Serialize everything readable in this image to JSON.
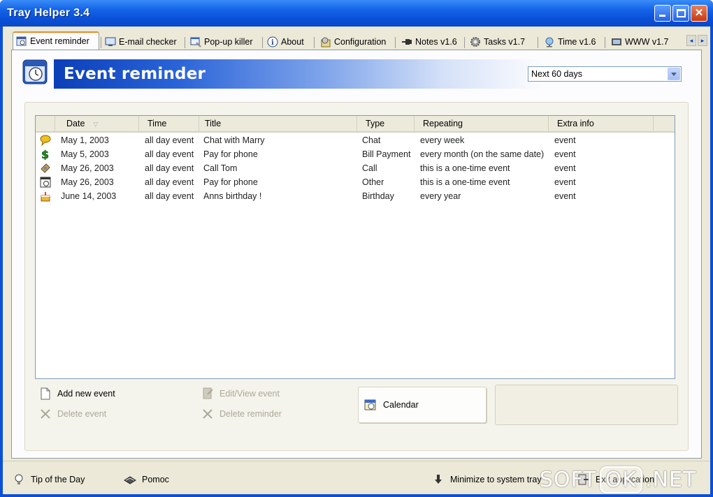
{
  "window": {
    "title": "Tray Helper  3.4"
  },
  "tabs": [
    {
      "label": "Event reminder",
      "icon": "calendar-icon",
      "active": true
    },
    {
      "label": "E-mail checker",
      "icon": "monitor-mail-icon"
    },
    {
      "label": "Pop-up killer",
      "icon": "popup-window-icon"
    },
    {
      "label": "About",
      "icon": "info-icon"
    },
    {
      "label": "Configuration",
      "icon": "configuration-icon"
    },
    {
      "label": "Notes v1.6",
      "icon": "pin-icon"
    },
    {
      "label": "Tasks v1.7",
      "icon": "gear-icon"
    },
    {
      "label": "Time v1.6",
      "icon": "globe-icon"
    },
    {
      "label": "WWW v1.7",
      "icon": "web-icon"
    }
  ],
  "header": {
    "title": "Event reminder",
    "range_select": "Next 60 days"
  },
  "list": {
    "columns": [
      "Date",
      "Time",
      "Title",
      "Type",
      "Repeating",
      "Extra info"
    ],
    "rows": [
      {
        "icon": "chat-bubble-icon",
        "date": "May  1, 2003",
        "time": "all day event",
        "title": "Chat with Marry",
        "type": "Chat",
        "repeating": "every week",
        "extra": "event"
      },
      {
        "icon": "dollar-icon",
        "date": "May  5, 2003",
        "time": "all day event",
        "title": "Pay for phone",
        "type": "Bill Payment",
        "repeating": "every month (on the same date)",
        "extra": "event"
      },
      {
        "icon": "phone-icon",
        "date": "May 26, 2003",
        "time": "all day event",
        "title": "Call Tom",
        "type": "Call",
        "repeating": "this is a one-time event",
        "extra": "event"
      },
      {
        "icon": "calendar-clock-icon",
        "date": "May 26, 2003",
        "time": "all day event",
        "title": "Pay for phone",
        "type": "Other",
        "repeating": "this is a one-time event",
        "extra": "event"
      },
      {
        "icon": "birthday-cake-icon",
        "date": "June 14, 2003",
        "time": "all day event",
        "title": "Anns birthday !",
        "type": "Birthday",
        "repeating": "every year",
        "extra": "event"
      }
    ]
  },
  "actions": {
    "add": "Add new event",
    "delete": "Delete event",
    "edit": "Edit/View event",
    "delete_reminder": "Delete reminder",
    "calendar": "Calendar"
  },
  "status": {
    "tip": "Tip of the Day",
    "help": "Pomoc",
    "minimize": "Minimize to system tray",
    "exit": "Exit application"
  },
  "watermark": {
    "left": "SOFT",
    "box": "OK",
    "right": ".NET"
  }
}
